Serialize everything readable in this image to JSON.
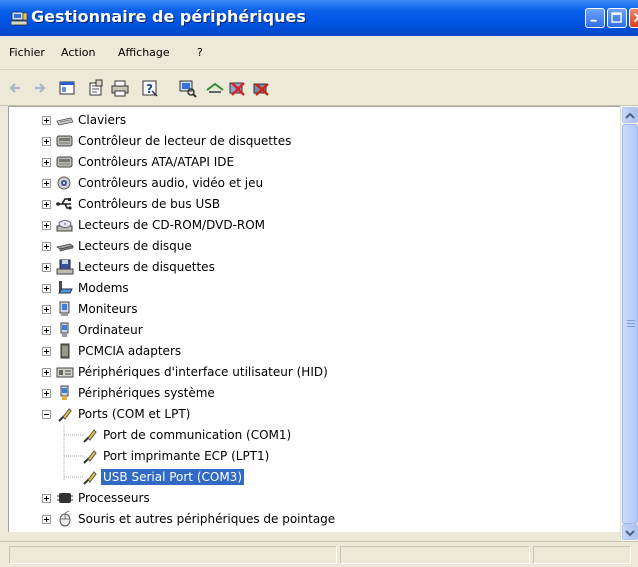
{
  "window": {
    "title": "Gestionnaire de périphériques"
  },
  "menu": {
    "items": [
      "Fichier",
      "Action",
      "Affichage",
      "?"
    ]
  },
  "toolbar": {
    "buttons": [
      "back-icon",
      "forward-icon",
      "console-tree-icon",
      "properties-icon",
      "print-icon",
      "help-icon",
      "scan-hardware-icon",
      "update-driver-icon",
      "uninstall-icon",
      "disable-icon"
    ]
  },
  "tree": {
    "items": [
      {
        "label": "Claviers",
        "icon": "keyboard-icon",
        "expanded": false
      },
      {
        "label": "Contrôleur de lecteur de disquettes",
        "icon": "floppy-controller-icon",
        "expanded": false
      },
      {
        "label": "Contrôleurs ATA/ATAPI IDE",
        "icon": "ide-controller-icon",
        "expanded": false
      },
      {
        "label": "Contrôleurs audio, vidéo et jeu",
        "icon": "audio-icon",
        "expanded": false
      },
      {
        "label": "Contrôleurs de bus USB",
        "icon": "usb-icon",
        "expanded": false
      },
      {
        "label": "Lecteurs de CD-ROM/DVD-ROM",
        "icon": "cdrom-icon",
        "expanded": false
      },
      {
        "label": "Lecteurs de disque",
        "icon": "disk-drive-icon",
        "expanded": false
      },
      {
        "label": "Lecteurs de disquettes",
        "icon": "floppy-drive-icon",
        "expanded": false
      },
      {
        "label": "Modems",
        "icon": "modem-icon",
        "expanded": false
      },
      {
        "label": "Moniteurs",
        "icon": "monitor-icon",
        "expanded": false
      },
      {
        "label": "Ordinateur",
        "icon": "computer-icon",
        "expanded": false
      },
      {
        "label": "PCMCIA adapters",
        "icon": "pcmcia-icon",
        "expanded": false
      },
      {
        "label": "Périphériques d'interface utilisateur (HID)",
        "icon": "hid-icon",
        "expanded": false
      },
      {
        "label": "Périphériques système",
        "icon": "system-device-icon",
        "expanded": false
      },
      {
        "label": "Ports (COM et LPT)",
        "icon": "port-icon",
        "expanded": true
      },
      {
        "label": "Port de communication (COM1)",
        "icon": "port-icon",
        "child": true
      },
      {
        "label": "Port imprimante ECP (LPT1)",
        "icon": "port-icon",
        "child": true
      },
      {
        "label": "USB Serial Port (COM3)",
        "icon": "port-icon",
        "child": true,
        "selected": true
      },
      {
        "label": "Processeurs",
        "icon": "processor-icon",
        "expanded": false
      },
      {
        "label": "Souris et autres périphériques de pointage",
        "icon": "mouse-icon",
        "expanded": false
      }
    ]
  },
  "colors": {
    "titlebar": "#0054E3",
    "selection": "#316AC5",
    "chrome": "#ECE9D8"
  }
}
